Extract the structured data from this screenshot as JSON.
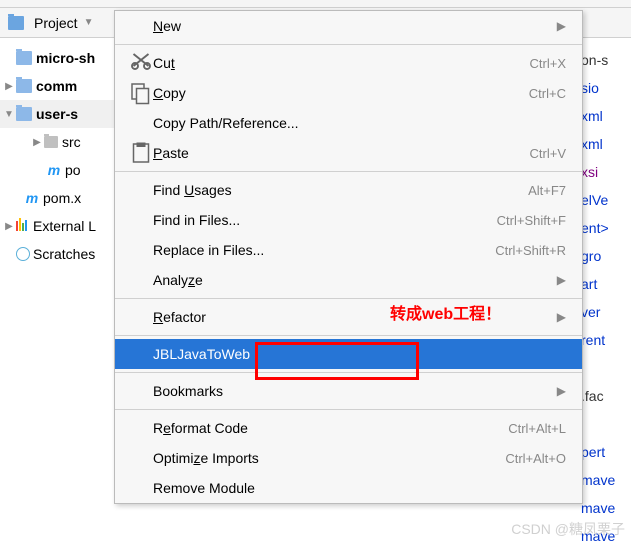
{
  "toolbar": {
    "project_label": "Project"
  },
  "tree": {
    "items": [
      {
        "label": "micro-sh",
        "bold": true
      },
      {
        "label": "comm",
        "bold": true
      },
      {
        "label": "user-s",
        "bold": true
      },
      {
        "label": "src"
      },
      {
        "label": "po"
      },
      {
        "label": "pom.x"
      },
      {
        "label": "External L"
      },
      {
        "label": "Scratches"
      }
    ]
  },
  "menu": {
    "items": [
      {
        "type": "item",
        "label_pre": "",
        "label_u": "N",
        "label_post": "ew",
        "shortcut": "",
        "arrow": true
      },
      {
        "type": "sep"
      },
      {
        "type": "item",
        "icon": "cut",
        "label_pre": "Cu",
        "label_u": "t",
        "label_post": "",
        "shortcut": "Ctrl+X"
      },
      {
        "type": "item",
        "icon": "copy",
        "label_pre": "",
        "label_u": "C",
        "label_post": "opy",
        "shortcut": "Ctrl+C"
      },
      {
        "type": "item",
        "label_pre": "Copy Path/Reference...",
        "label_u": "",
        "label_post": ""
      },
      {
        "type": "item",
        "icon": "paste",
        "label_pre": "",
        "label_u": "P",
        "label_post": "aste",
        "shortcut": "Ctrl+V"
      },
      {
        "type": "sep"
      },
      {
        "type": "item",
        "label_pre": "Find ",
        "label_u": "U",
        "label_post": "sages",
        "shortcut": "Alt+F7"
      },
      {
        "type": "item",
        "label_pre": "Find in Files...",
        "shortcut": "Ctrl+Shift+F"
      },
      {
        "type": "item",
        "label_pre": "Replace in Files...",
        "shortcut": "Ctrl+Shift+R"
      },
      {
        "type": "item",
        "label_pre": "Analy",
        "label_u": "z",
        "label_post": "e",
        "arrow": true
      },
      {
        "type": "sep"
      },
      {
        "type": "item",
        "label_pre": "",
        "label_u": "R",
        "label_post": "efactor",
        "arrow": true
      },
      {
        "type": "sep"
      },
      {
        "type": "item",
        "label_pre": "JBLJavaToWeb",
        "highlighted": true
      },
      {
        "type": "sep"
      },
      {
        "type": "item",
        "label_pre": "Bookmarks",
        "arrow": true
      },
      {
        "type": "sep"
      },
      {
        "type": "item",
        "label_pre": "R",
        "label_u": "e",
        "label_post": "format Code",
        "shortcut": "Ctrl+Alt+L"
      },
      {
        "type": "item",
        "label_pre": "Optimi",
        "label_u": "z",
        "label_post": "e Imports",
        "shortcut": "Ctrl+Alt+O"
      },
      {
        "type": "item",
        "label_pre": "Remove Module"
      }
    ]
  },
  "code_fragments": [
    "on-s",
    "sio",
    "xml",
    "xml",
    "xsi",
    "elVe",
    "ent>",
    "gro",
    "art",
    "ver",
    "rent",
    "",
    ".fac",
    "",
    "pert",
    "mave",
    "mave",
    "mave"
  ],
  "code_styles": [
    "",
    "kw-blue",
    "kw-blue",
    "kw-blue",
    "kw-purple",
    "kw-blue",
    "kw-blue",
    "kw-blue",
    "kw-blue",
    "kw-blue",
    "kw-blue",
    "",
    "",
    "",
    "kw-blue",
    "kw-blue",
    "kw-blue",
    "kw-blue"
  ],
  "annotation": "转成web工程！",
  "watermark": "CSDN @糖凤栗子"
}
